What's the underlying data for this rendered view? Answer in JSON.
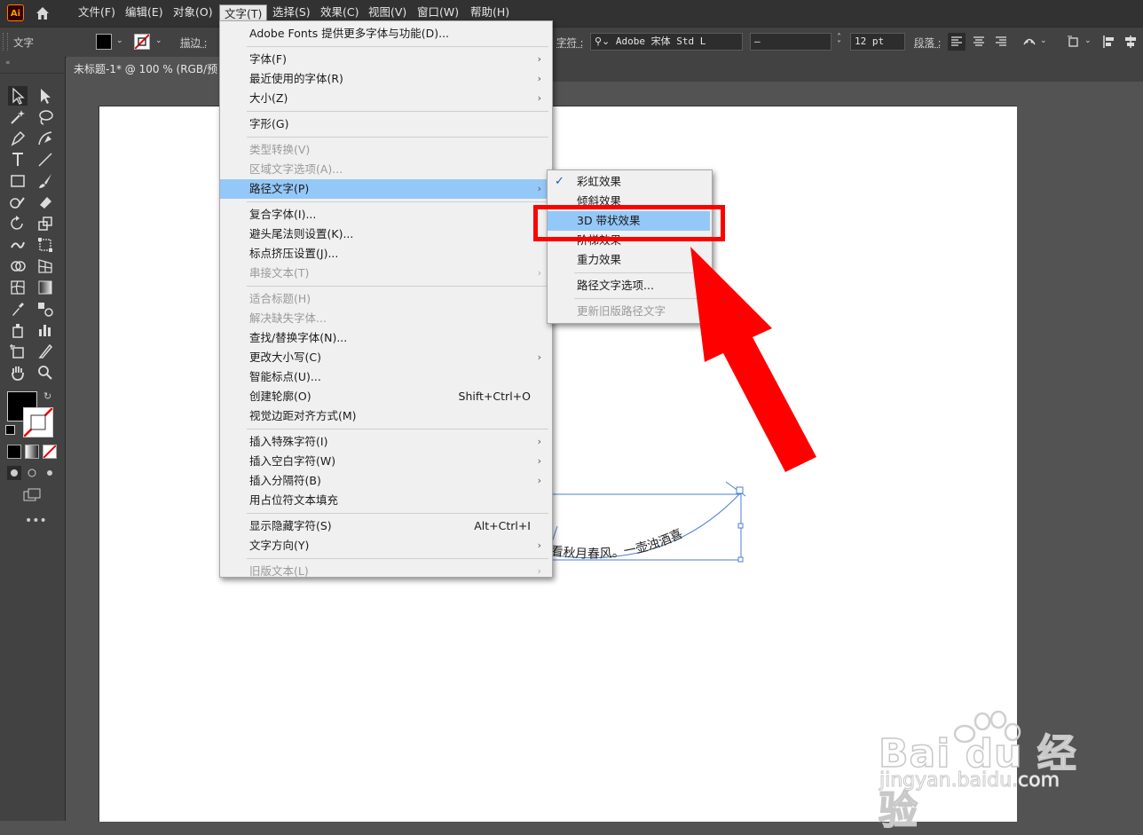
{
  "app": {
    "logo": "Ai"
  },
  "menubar": {
    "items": [
      "文件(F)",
      "编辑(E)",
      "对象(O)",
      "文字(T)",
      "选择(S)",
      "效果(C)",
      "视图(V)",
      "窗口(W)",
      "帮助(H)"
    ]
  },
  "control_bar": {
    "tool_name": "文字",
    "stroke_label": "描边 :",
    "char_label": "字符 :",
    "font_name": "Adobe 宋体 Std L",
    "font_style": "–",
    "font_size": "12 pt",
    "para_label": "段落 :"
  },
  "document": {
    "tab_title": "未标题-1* @ 100 % (RGB/预"
  },
  "type_menu": {
    "items": [
      {
        "label": "Adobe Fonts 提供更多字体与功能(D)...",
        "shortcut": "",
        "submenu": false,
        "disabled": false
      },
      {
        "label": "字体(F)",
        "shortcut": "",
        "submenu": true,
        "disabled": false
      },
      {
        "label": "最近使用的字体(R)",
        "shortcut": "",
        "submenu": true,
        "disabled": false
      },
      {
        "label": "大小(Z)",
        "shortcut": "",
        "submenu": true,
        "disabled": false
      },
      {
        "label": "字形(G)",
        "shortcut": "",
        "submenu": false,
        "disabled": false
      },
      {
        "label": "类型转换(V)",
        "shortcut": "",
        "submenu": false,
        "disabled": true
      },
      {
        "label": "区域文字选项(A)...",
        "shortcut": "",
        "submenu": false,
        "disabled": true
      },
      {
        "label": "路径文字(P)",
        "shortcut": "",
        "submenu": true,
        "disabled": false,
        "highlighted": true
      },
      {
        "label": "复合字体(I)...",
        "shortcut": "",
        "submenu": false,
        "disabled": false
      },
      {
        "label": "避头尾法则设置(K)...",
        "shortcut": "",
        "submenu": false,
        "disabled": false
      },
      {
        "label": "标点挤压设置(J)...",
        "shortcut": "",
        "submenu": false,
        "disabled": false
      },
      {
        "label": "串接文本(T)",
        "shortcut": "",
        "submenu": true,
        "disabled": true
      },
      {
        "label": "适合标题(H)",
        "shortcut": "",
        "submenu": false,
        "disabled": true
      },
      {
        "label": "解决缺失字体...",
        "shortcut": "",
        "submenu": false,
        "disabled": true
      },
      {
        "label": "查找/替换字体(N)...",
        "shortcut": "",
        "submenu": false,
        "disabled": false
      },
      {
        "label": "更改大小写(C)",
        "shortcut": "",
        "submenu": true,
        "disabled": false
      },
      {
        "label": "智能标点(U)...",
        "shortcut": "",
        "submenu": false,
        "disabled": false
      },
      {
        "label": "创建轮廓(O)",
        "shortcut": "Shift+Ctrl+O",
        "submenu": false,
        "disabled": false
      },
      {
        "label": "视觉边距对齐方式(M)",
        "shortcut": "",
        "submenu": false,
        "disabled": false
      },
      {
        "label": "插入特殊字符(I)",
        "shortcut": "",
        "submenu": true,
        "disabled": false
      },
      {
        "label": "插入空白字符(W)",
        "shortcut": "",
        "submenu": true,
        "disabled": false
      },
      {
        "label": "插入分隔符(B)",
        "shortcut": "",
        "submenu": true,
        "disabled": false
      },
      {
        "label": "用占位符文本填充",
        "shortcut": "",
        "submenu": false,
        "disabled": false
      },
      {
        "label": "显示隐藏字符(S)",
        "shortcut": "Alt+Ctrl+I",
        "submenu": false,
        "disabled": false
      },
      {
        "label": "文字方向(Y)",
        "shortcut": "",
        "submenu": true,
        "disabled": false
      },
      {
        "label": "旧版文本(L)",
        "shortcut": "",
        "submenu": true,
        "disabled": true
      }
    ]
  },
  "path_submenu": {
    "items": [
      {
        "label": "彩虹效果",
        "checked": true,
        "disabled": false
      },
      {
        "label": "倾斜效果",
        "checked": false,
        "disabled": false
      },
      {
        "label": "3D 带状效果",
        "checked": false,
        "disabled": false,
        "highlighted": true
      },
      {
        "label": "阶梯效果",
        "checked": false,
        "disabled": false
      },
      {
        "label": "重力效果",
        "checked": false,
        "disabled": false
      },
      {
        "label": "路径文字选项...",
        "checked": false,
        "disabled": false
      },
      {
        "label": "更新旧版路径文字",
        "checked": false,
        "disabled": true
      }
    ]
  },
  "canvas": {
    "path_text": "看秋月春风。一壶浊酒喜"
  },
  "watermark": {
    "brand": "Bai du 经验",
    "url": "jingyan.baidu.com"
  },
  "colors": {
    "highlight": "#94c8f8",
    "callout_red": "#ff0000",
    "path_blue": "#4a7fd0"
  }
}
